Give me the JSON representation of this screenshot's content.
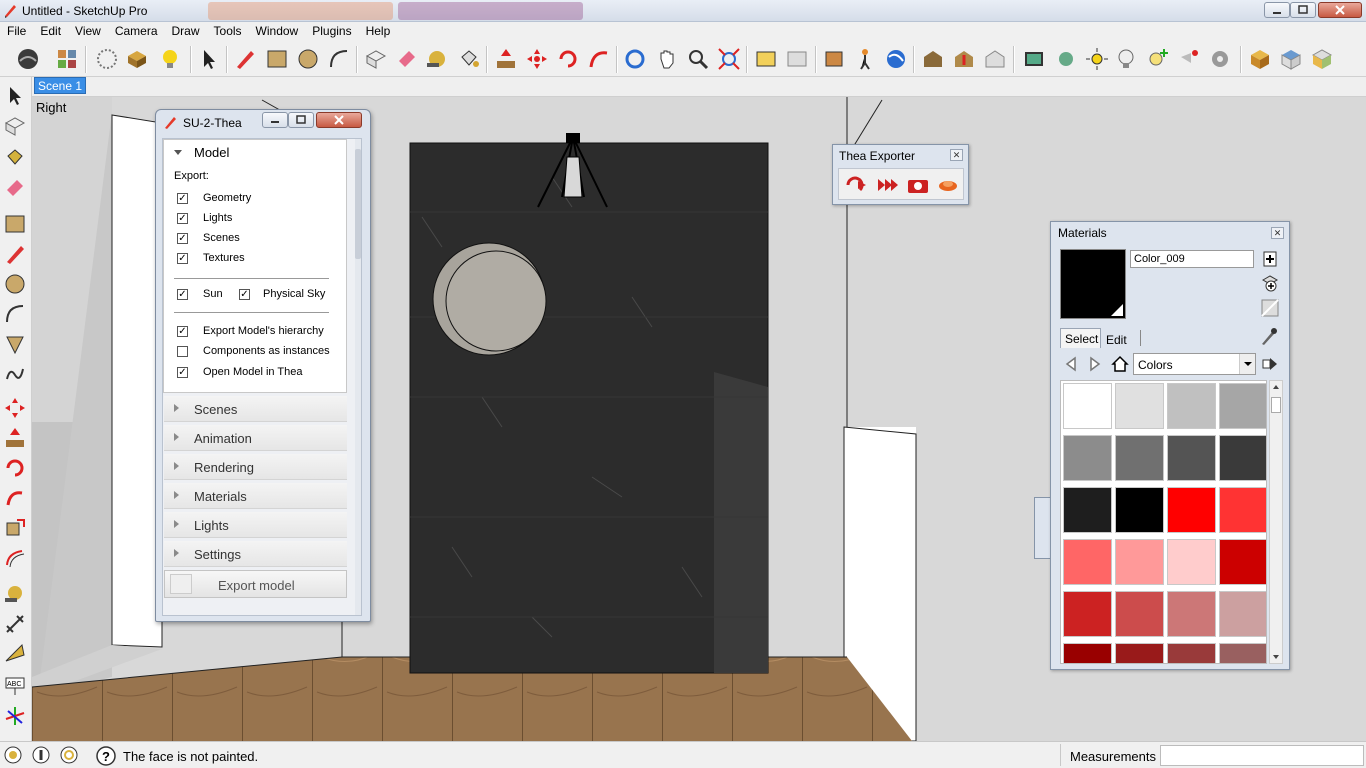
{
  "window": {
    "title": "Untitled - SketchUp Pro"
  },
  "menu": [
    "File",
    "Edit",
    "View",
    "Camera",
    "Draw",
    "Tools",
    "Window",
    "Plugins",
    "Help"
  ],
  "scene_tab": "Scene 1",
  "view_label": "Right",
  "status": {
    "message": "The face is not painted.",
    "measurements_label": "Measurements",
    "measurements_value": ""
  },
  "thea_panel": {
    "title": "SU-2-Thea",
    "model_section": "Model",
    "export_label": "Export:",
    "options": [
      {
        "label": "Geometry",
        "checked": true
      },
      {
        "label": "Lights",
        "checked": true
      },
      {
        "label": "Scenes",
        "checked": true
      },
      {
        "label": "Textures",
        "checked": true
      }
    ],
    "sun": {
      "label": "Sun",
      "checked": true
    },
    "physical_sky": {
      "label": "Physical Sky",
      "checked": true
    },
    "options2": [
      {
        "label": "Export Model's hierarchy",
        "checked": true
      },
      {
        "label": "Components as instances",
        "checked": false
      },
      {
        "label": "Open Model in Thea",
        "checked": true
      }
    ],
    "sections": [
      "Scenes",
      "Animation",
      "Rendering",
      "Materials",
      "Lights",
      "Settings"
    ],
    "export_button": "Export model"
  },
  "thea_exporter": {
    "title": "Thea Exporter"
  },
  "materials": {
    "title": "Materials",
    "name": "Color_009",
    "tab_select": "Select",
    "tab_edit": "Edit",
    "collection": "Colors",
    "swatches": [
      "#ffffff",
      "#e0e0e0",
      "#c0c0c0",
      "#a6a6a6",
      "#8c8c8c",
      "#707070",
      "#545454",
      "#3a3a3a",
      "#1e1e1e",
      "#000000",
      "#ff0000",
      "#ff3333",
      "#ff6666",
      "#ff9999",
      "#ffcccc",
      "#cc0000",
      "#cc2222",
      "#cc4c4c",
      "#cc7777",
      "#cca0a0",
      "#990000",
      "#991a1a",
      "#993a3a",
      "#996060"
    ]
  }
}
